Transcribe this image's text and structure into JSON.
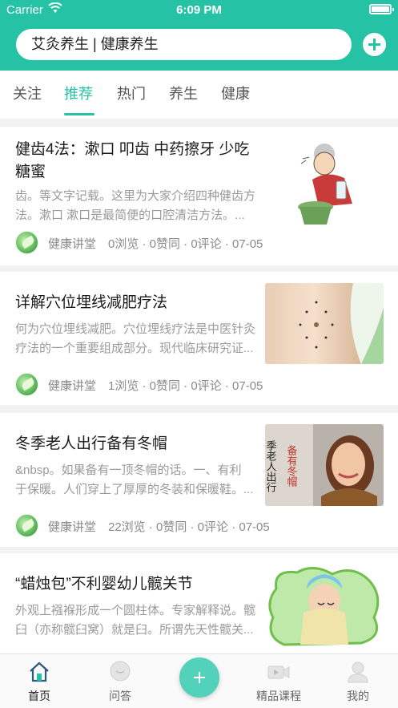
{
  "status_bar": {
    "carrier": "Carrier",
    "time": "6:09 PM"
  },
  "search": {
    "text": "艾灸养生 | 健康养生"
  },
  "tabs": [
    {
      "label": "关注",
      "active": false
    },
    {
      "label": "推荐",
      "active": true
    },
    {
      "label": "热门",
      "active": false
    },
    {
      "label": "养生",
      "active": false
    },
    {
      "label": "健康",
      "active": false
    }
  ],
  "articles": [
    {
      "title_line1": "健齿4法：漱口 叩齿 中药擦牙 少吃",
      "title_line2": "糖蜜",
      "desc_line1": "齿。等文字记载。这里为大家介绍四种健齿方",
      "desc_line2": "法。漱口 漱口是最简便的口腔清洁方法。...",
      "author": "健康讲堂",
      "stats": "0浏览 · 0赞同 · 0评论 · 07-05",
      "thumb_icon": "elderly-woman-gargling-illustration"
    },
    {
      "title_line1": "详解穴位埋线减肥疗法",
      "desc_line1": "何为穴位埋线减肥。穴位埋线疗法是中医针灸",
      "desc_line2": "疗法的一个重要组成部分。现代临床研究证...",
      "author": "健康讲堂",
      "stats": "1浏览 · 0赞同 · 0评论 · 07-05",
      "thumb_icon": "abdomen-acupoints-photo"
    },
    {
      "title_line1": "冬季老人出行备有冬帽",
      "desc_line1": "&nbsp。如果备有一顶冬帽的话。一、有利",
      "desc_line2": "于保暖。人们穿上了厚厚的冬装和保暖鞋。...",
      "author": "健康讲堂",
      "stats": "22浏览 · 0赞同 · 0评论 · 07-05",
      "thumb_icon": "winter-woman-photo",
      "thumb_text_a": "季老人出行",
      "thumb_text_b": "备有冬帽"
    },
    {
      "title_line1": "“蜡烛包”不利婴幼儿髋关节",
      "desc_line1": "外观上襁褓形成一个圆柱体。专家解释说。髋",
      "desc_line2": "臼（亦称髋臼窝）就是臼。所谓先天性髋关...",
      "thumb_icon": "swaddled-baby-illustration"
    }
  ],
  "tabbar": [
    {
      "label": "首页",
      "icon": "home-icon",
      "active": true
    },
    {
      "label": "问答",
      "icon": "chat-bubble-icon",
      "active": false
    },
    {
      "label": "精品课程",
      "icon": "video-camera-icon",
      "active": false
    },
    {
      "label": "我的",
      "icon": "profile-icon",
      "active": false
    }
  ],
  "colors": {
    "accent": "#26c2a5",
    "center_button": "#52d1bb"
  }
}
